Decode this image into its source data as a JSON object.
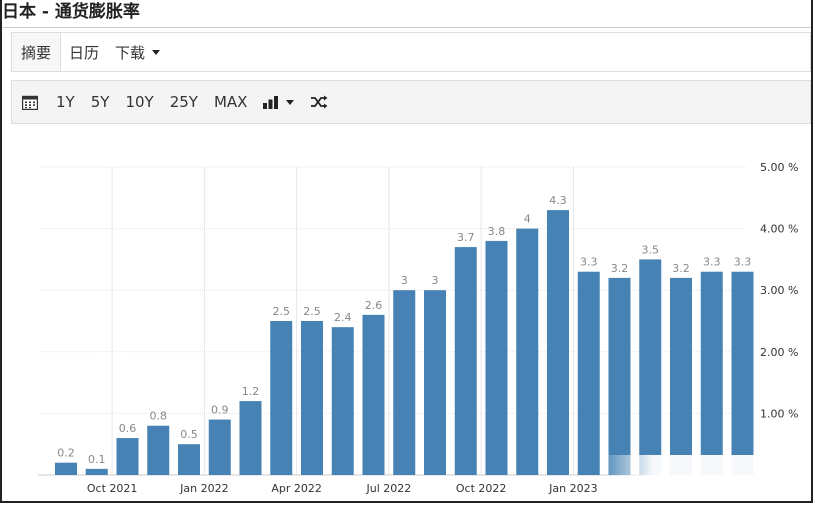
{
  "page": {
    "title": "日本 - 通货膨胀率"
  },
  "nav": {
    "tabs": [
      {
        "label": "摘要",
        "active": true
      },
      {
        "label": "日历",
        "active": false
      },
      {
        "label": "下载",
        "has_dropdown": true
      }
    ]
  },
  "toolbar": {
    "calendar_icon": "calendar-icon",
    "ranges": [
      "1Y",
      "5Y",
      "10Y",
      "25Y",
      "MAX"
    ],
    "chart_type_icon": "bar-chart-icon",
    "shuffle_icon": "shuffle-icon"
  },
  "colors": {
    "bar": "#4682b4",
    "grid": "#e6e6e6",
    "label": "#888888"
  },
  "chart_data": {
    "type": "bar",
    "values": [
      0.2,
      0.1,
      0.6,
      0.8,
      0.5,
      0.9,
      1.2,
      2.5,
      2.5,
      2.4,
      2.6,
      3,
      3,
      3.7,
      3.8,
      4,
      4.3,
      3.3,
      3.2,
      3.5,
      3.2,
      3.3,
      3.3
    ],
    "value_labels": [
      "0.2",
      "0.1",
      "0.6",
      "0.8",
      "0.5",
      "0.9",
      "1.2",
      "2.5",
      "2.5",
      "2.4",
      "2.6",
      "3",
      "3",
      "3.7",
      "3.8",
      "4",
      "4.3",
      "3.3",
      "3.2",
      "3.5",
      "3.2",
      "3.3",
      "3.3"
    ],
    "x_tick_labels": [
      {
        "label": "Oct 2021",
        "index": 1.5
      },
      {
        "label": "Jan 2022",
        "index": 4.5
      },
      {
        "label": "Apr 2022",
        "index": 7.5
      },
      {
        "label": "Jul 2022",
        "index": 10.5
      },
      {
        "label": "Oct 2022",
        "index": 13.5
      },
      {
        "label": "Jan 2023",
        "index": 16.5
      }
    ],
    "y_ticks": [
      1,
      2,
      3,
      4,
      5
    ],
    "y_tick_labels": [
      "1.00 %",
      "2.00 %",
      "3.00 %",
      "4.00 %",
      "5.00 %"
    ],
    "ylim": [
      0,
      5
    ],
    "grid": true,
    "y_axis_position": "right"
  }
}
